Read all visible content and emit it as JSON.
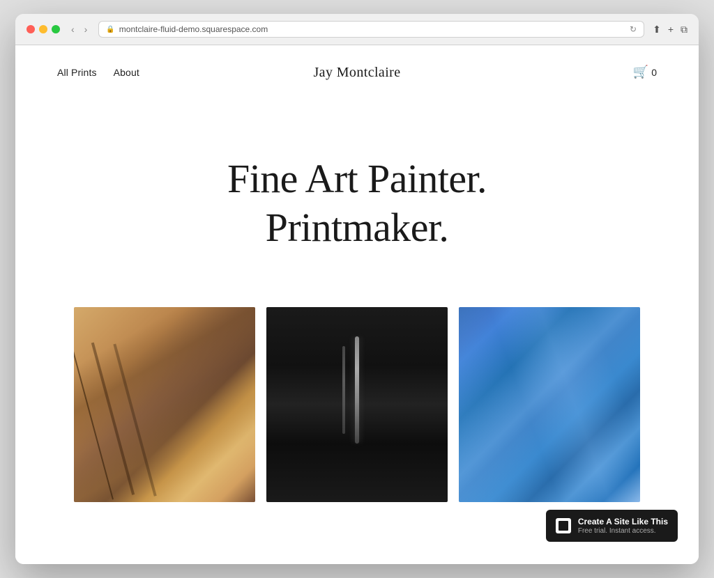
{
  "browser": {
    "url": "montclaire-fluid-demo.squarespace.com",
    "tab_icon": "🔒"
  },
  "nav": {
    "left_links": [
      {
        "label": "All Prints",
        "href": "#"
      },
      {
        "label": "About",
        "href": "#"
      }
    ],
    "site_title": "Jay Montclaire",
    "cart_icon": "🛒",
    "cart_count": "0"
  },
  "hero": {
    "line1": "Fine Art Painter.",
    "line2": "Printmaker."
  },
  "gallery": {
    "images": [
      {
        "alt": "Golden warm abstract painting",
        "style_class": "img-warm"
      },
      {
        "alt": "Dark black abstract painting",
        "style_class": "img-dark"
      },
      {
        "alt": "Blue abstract painting",
        "style_class": "img-blue"
      }
    ]
  },
  "badge": {
    "main_text": "Create A Site Like This",
    "sub_text": "Free trial. Instant access."
  }
}
